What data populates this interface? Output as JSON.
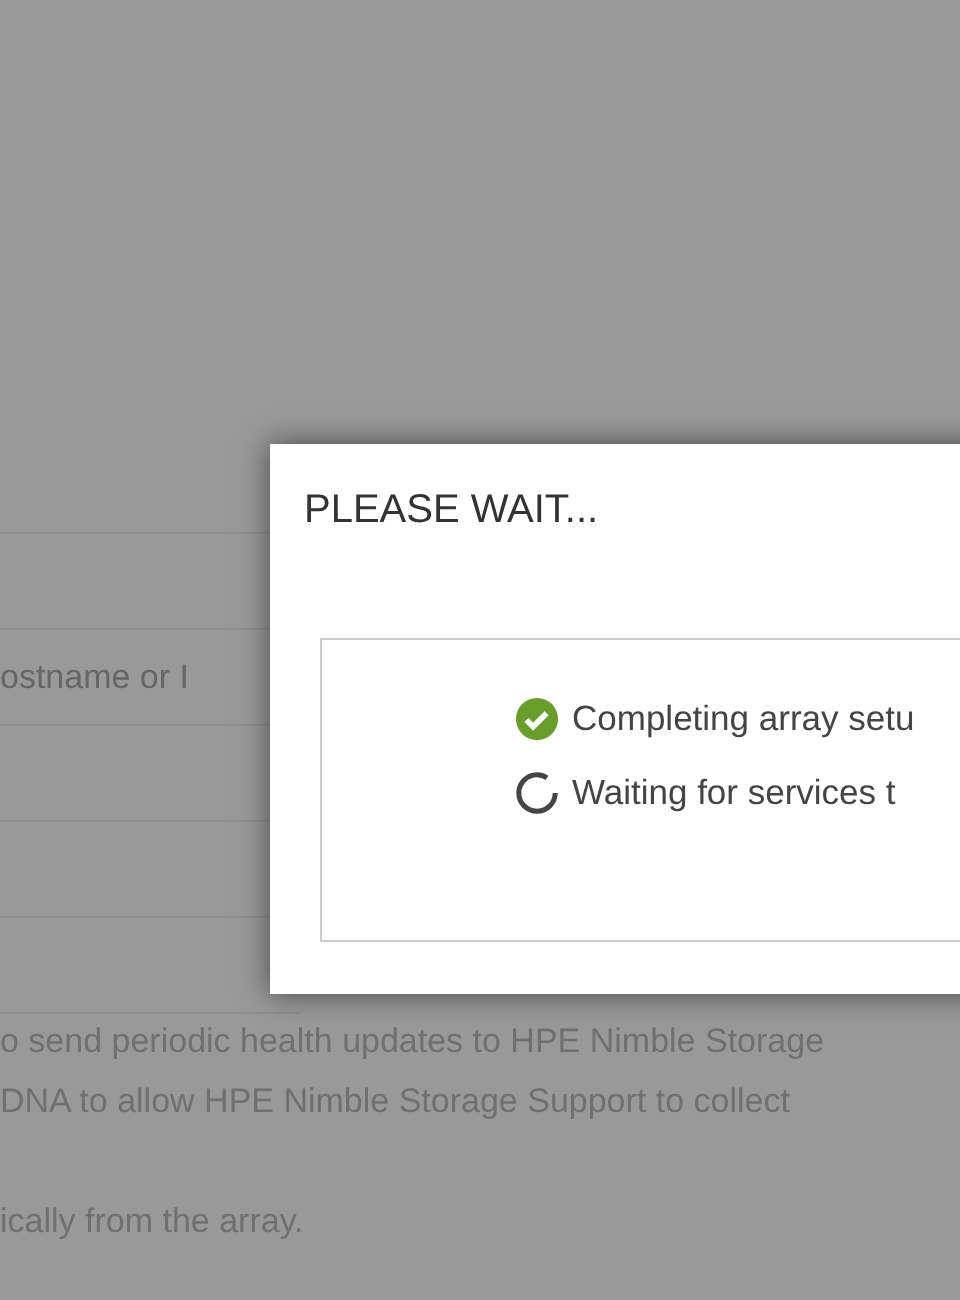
{
  "background_form": {
    "hostname_field": {
      "placeholder": "ostname or I"
    },
    "paragraph_lines": [
      "o send periodic health updates to HPE Nimble Storage",
      "DNA to allow HPE Nimble Storage Support to collect",
      "ically from the array."
    ]
  },
  "dialog": {
    "title": "PLEASE WAIT...",
    "steps": [
      {
        "label": "Completing array setu",
        "done": true
      },
      {
        "label": "Waiting for services t",
        "done": false
      }
    ]
  }
}
